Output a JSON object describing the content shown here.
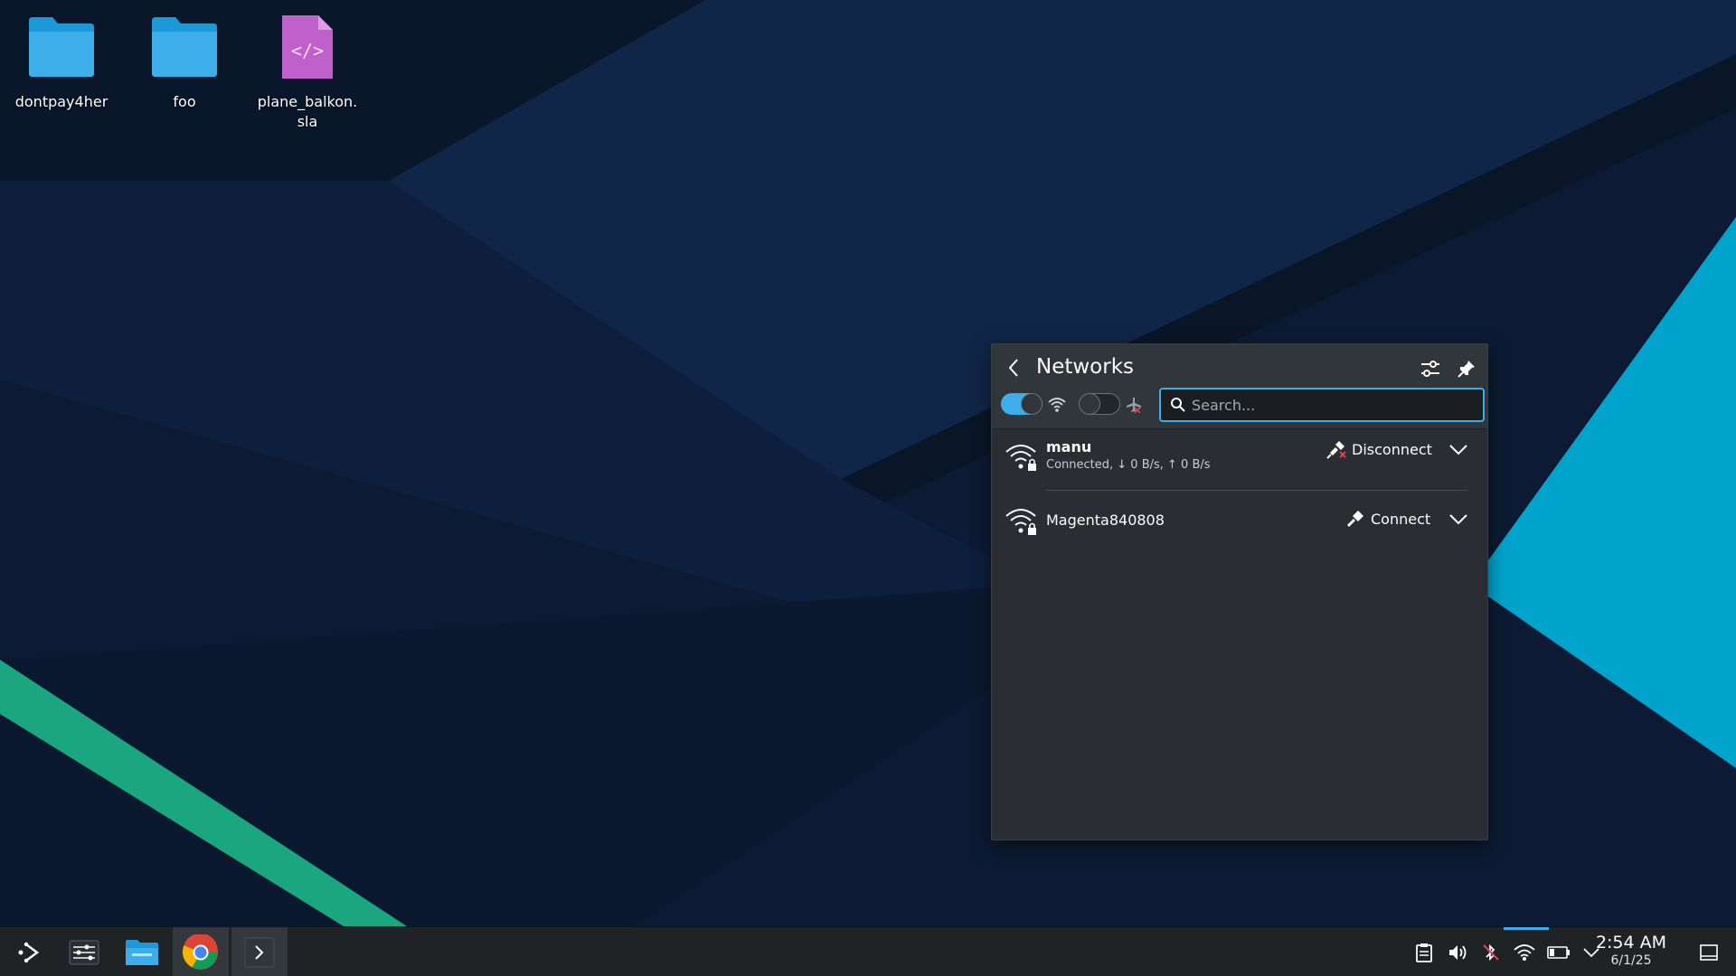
{
  "desktop": {
    "icons": [
      {
        "label": "dontpay4her",
        "type": "folder"
      },
      {
        "label": "foo",
        "type": "folder"
      },
      {
        "label": "plane_balkon.\nsla",
        "type": "code-file"
      }
    ]
  },
  "network_popup": {
    "title": "Networks",
    "wifi_enabled": true,
    "airplane_mode": false,
    "search": {
      "placeholder": "Search...",
      "value": ""
    },
    "networks": [
      {
        "ssid": "manu",
        "status": "Connected, ↓ 0 B/s, ↑ 0 B/s",
        "action": "Disconnect",
        "secured": true,
        "connected": true
      },
      {
        "ssid": "Magenta840808",
        "status": "",
        "action": "Connect",
        "secured": true,
        "connected": false
      }
    ]
  },
  "taskbar": {
    "apps": [
      "application-launcher",
      "system-settings",
      "file-manager",
      "chrome",
      "terminal"
    ],
    "tray_icons": [
      "clipboard",
      "volume",
      "bluetooth-disabled",
      "wifi",
      "battery",
      "expand-tray"
    ],
    "clock": {
      "time": "2:54 AM",
      "date": "6/1/25"
    }
  },
  "colors": {
    "accent": "#3daee9",
    "popup_bg": "#2a2e32",
    "taskbar_bg": "#202326",
    "wallpaper_green": "#1aa67f",
    "wallpaper_cyan": "#00a3cc"
  }
}
